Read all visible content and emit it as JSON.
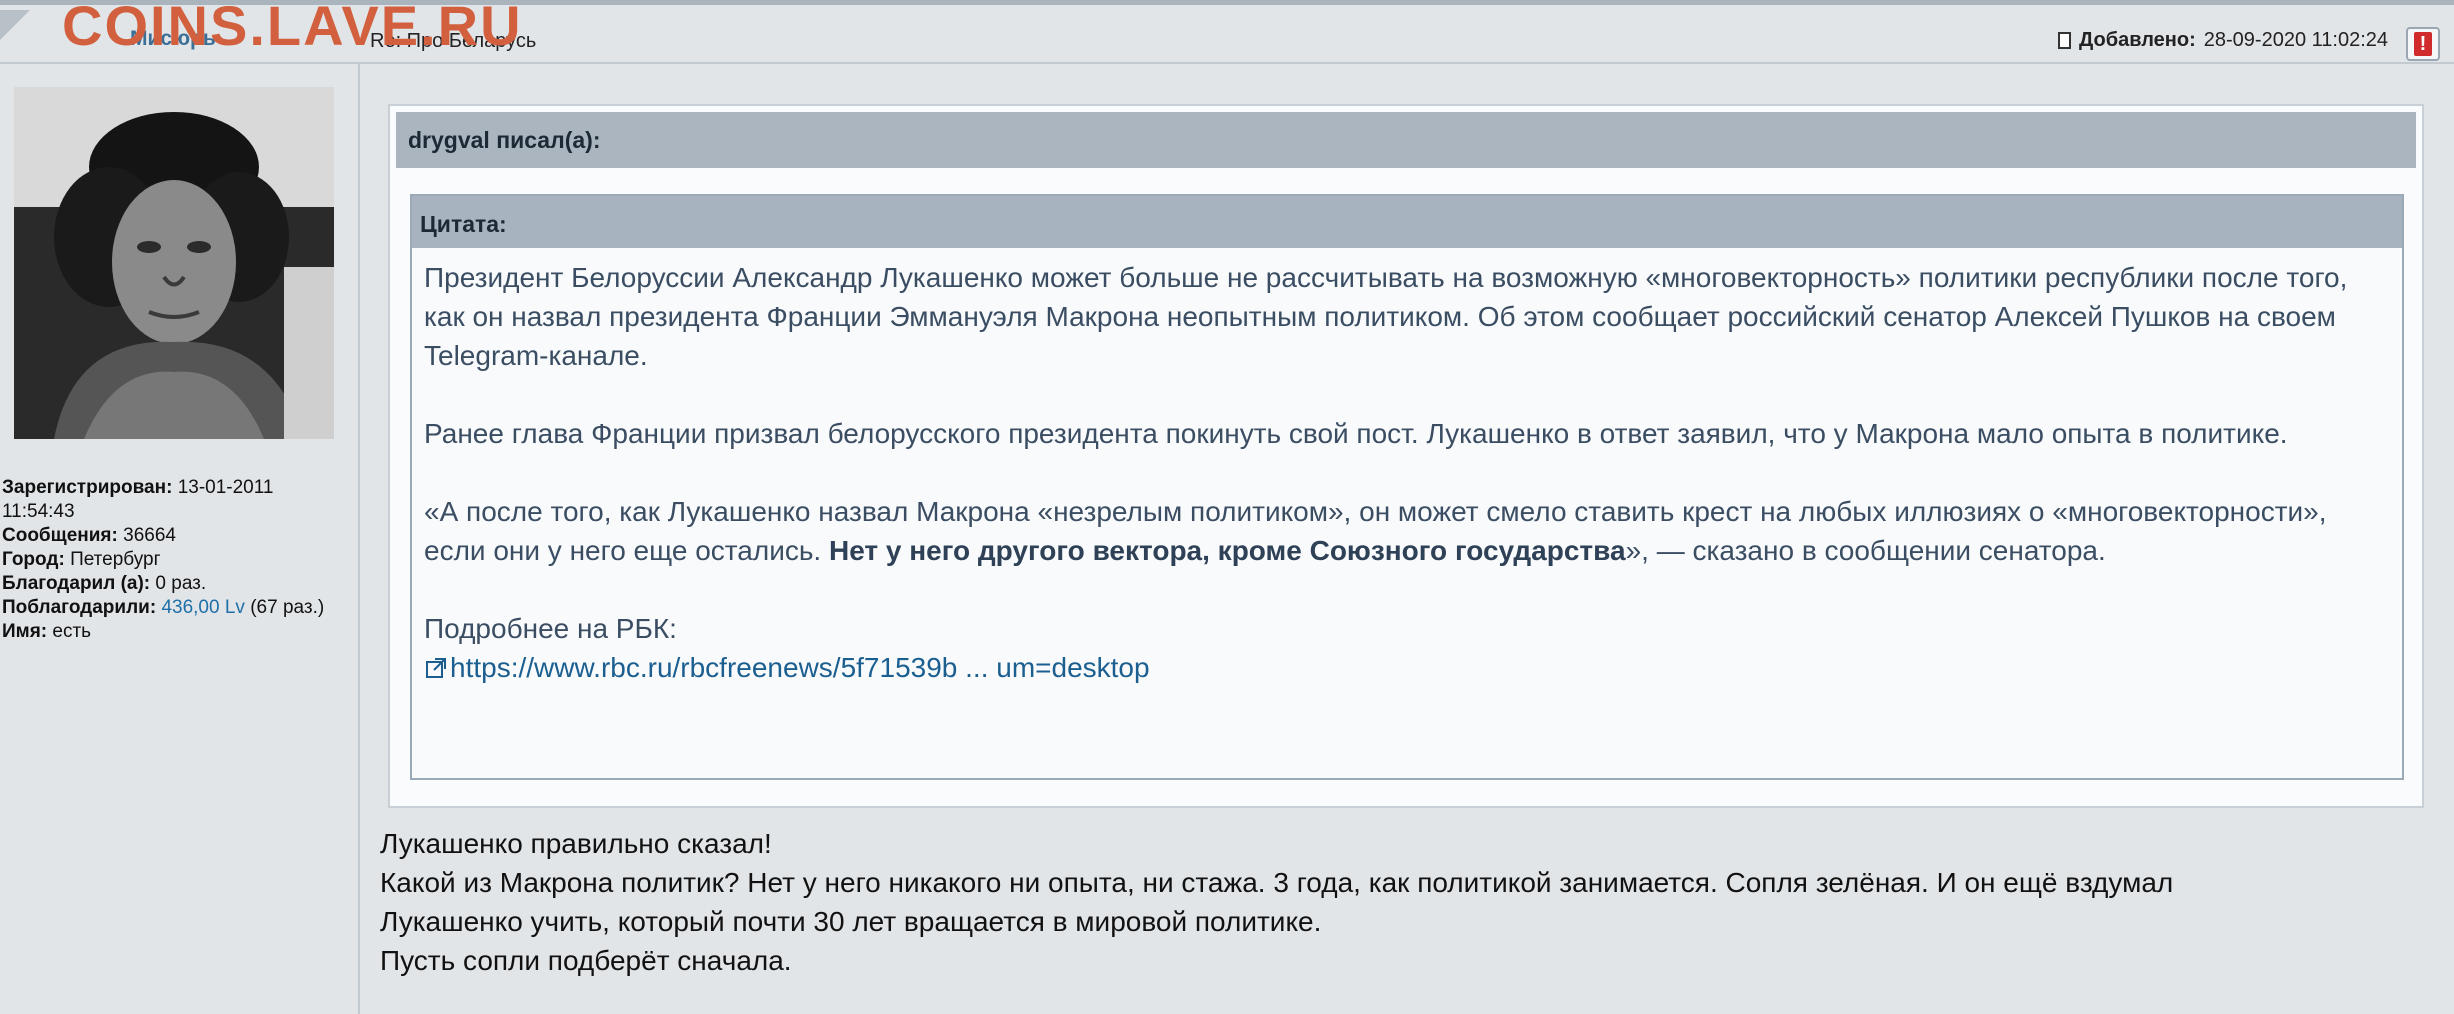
{
  "watermark": "COINS.LAVE.RU",
  "header": {
    "author": "Мисюрь",
    "subject": "Re: Про Беларусь",
    "added_label": "Добавлено:",
    "added_date": "28-09-2020 11:02:24",
    "report_symbol": "!"
  },
  "profile": {
    "registered_label": "Зарегистрирован:",
    "registered_value": "13-01-2011",
    "registered_time": "11:54:43",
    "messages_label": "Сообщения:",
    "messages_value": "36664",
    "city_label": "Город:",
    "city_value": "Петербург",
    "thanked_label": "Благодарил (а):",
    "thanked_value": "0 раз.",
    "thanked_by_label": "Поблагодарили:",
    "thanked_by_amount": "436,00 Lv",
    "thanked_by_count": "(67 раз.)",
    "name_label": "Имя:",
    "name_value": "есть"
  },
  "quote": {
    "outer_title": "drygval писал(а):",
    "inner_title": "Цитата:",
    "p1": "Президент Белоруссии Александр Лукашенко может больше не рассчитывать на возможную «многовекторность» политики республики после того, как он назвал президента Франции Эммануэля Макрона неопытным политиком. Об этом сообщает российский сенатор Алексей Пушков на своем Telegram-канале.",
    "p2": "Ранее глава Франции призвал белорусского президента покинуть свой пост. Лукашенко в ответ заявил, что у Макрона мало опыта в политике.",
    "p3_start": "«А после того, как Лукашенко назвал Макрона «незрелым политиком», он может смело ставить крест на любых иллюзиях о «многовекторности», если они у него еще остались. ",
    "p3_bold": "Нет у него другого вектора, кроме Союзного государства",
    "p3_end": "», — сказано в сообщении сенатора.",
    "more_label": "Подробнее на РБК:",
    "link_text": "https://www.rbc.ru/rbcfreenews/5f71539b ... um=desktop"
  },
  "reply": {
    "line1": "Лукашенко правильно сказал!",
    "line2": "Какой из Макрона политик? Нет у него никакого ни опыта, ни стажа. 3 года, как политикой занимается. Сопля зелёная. И он ещё вздумал",
    "line3": "Лукашенко учить, который почти 30 лет вращается в мировой политике.",
    "line4": "Пусть сопли подберёт сначала."
  }
}
